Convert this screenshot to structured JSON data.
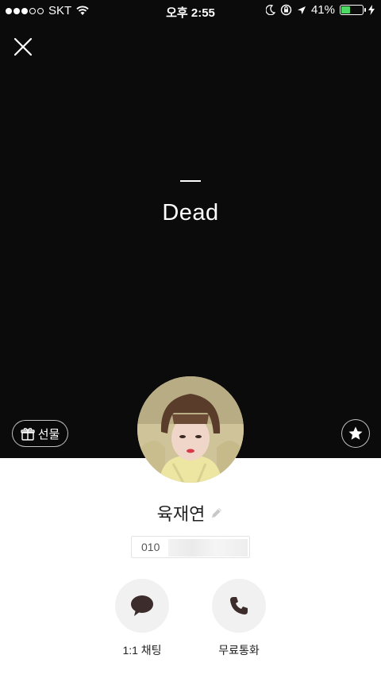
{
  "status_bar": {
    "carrier": "SKT",
    "time": "오후 2:55",
    "battery": "41%",
    "battery_level": 0.41,
    "icons": [
      "wifi-icon",
      "moon-icon",
      "rotation-lock-icon",
      "location-arrow-icon",
      "charging-bolt-icon"
    ]
  },
  "profile": {
    "status_message": "Dead",
    "name": "육재연",
    "phone_prefix": "010"
  },
  "buttons": {
    "gift_label": "선물",
    "chat_label": "1:1 채팅",
    "call_label": "무료통화"
  },
  "colors": {
    "cover_background": "#0b0b0b",
    "battery_green": "#4cd964",
    "action_icon": "#3c2c2c"
  }
}
